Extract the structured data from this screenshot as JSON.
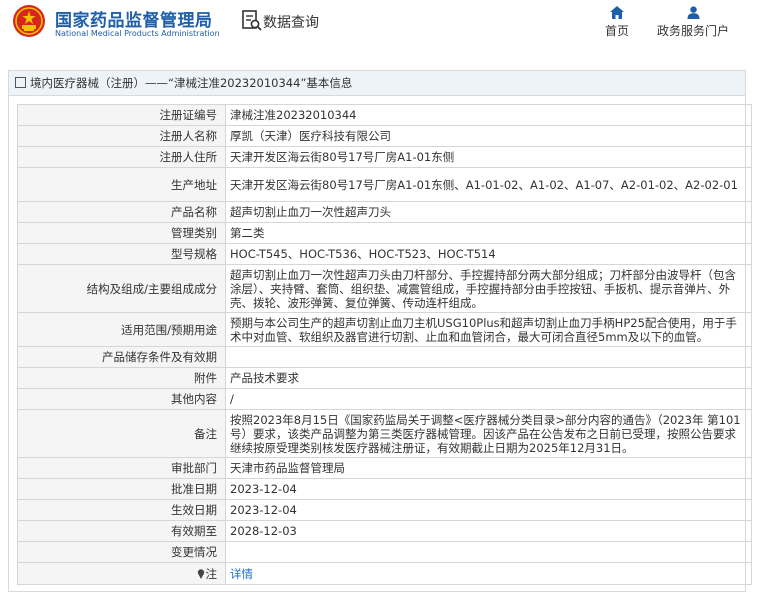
{
  "header": {
    "brand_cn": "国家药品监督管理局",
    "brand_en": "National Medical Products Administration",
    "query_label": "数据查询",
    "nav": [
      {
        "label": "首页",
        "icon": "home-icon"
      },
      {
        "label": "政务服务门户",
        "icon": "user-icon"
      }
    ],
    "brand_color": "#1f5ea8"
  },
  "breadcrumb": {
    "part1": "境内医疗器械（注册）",
    "part2": "——“津械注准20232010344”基本信息"
  },
  "table": {
    "rows": [
      {
        "label": "注册证编号",
        "value": "津械注准20232010344"
      },
      {
        "label": "注册人名称",
        "value": "厚凯（天津）医疗科技有限公司"
      },
      {
        "label": "注册人住所",
        "value": "天津开发区海云街80号17号厂房A1-01东侧"
      },
      {
        "label": "生产地址",
        "value": "天津开发区海云街80号17号厂房A1-01东侧、A1-01-02、A1-02、A1-07、A2-01-02、A2-02-01"
      },
      {
        "label": "产品名称",
        "value": "超声切割止血刀一次性超声刀头"
      },
      {
        "label": "管理类别",
        "value": "第二类"
      },
      {
        "label": "型号规格",
        "value": "HOC-T545、HOC-T536、HOC-T523、HOC-T514"
      },
      {
        "label": "结构及组成/主要组成成分",
        "value": "超声切割止血刀一次性超声刀头由刀杆部分、手控握持部分两大部分组成；刀杆部分由波导杆（包含涂层）、夹持臂、套筒、组织垫、减震管组成，手控握持部分由手控按钮、手扳机、提示音弹片、外壳、拨轮、波形弹簧、复位弹簧、传动连杆组成。"
      },
      {
        "label": "适用范围/预期用途",
        "value": "预期与本公司生产的超声切割止血刀主机USG10Plus和超声切割止血刀手柄HP25配合使用，用于手术中对血管、软组织及器官进行切割、止血和血管闭合，最大可闭合直径5mm及以下的血管。"
      },
      {
        "label": "产品储存条件及有效期",
        "value": ""
      },
      {
        "label": "附件",
        "value": "产品技术要求"
      },
      {
        "label": "其他内容",
        "value": "/"
      },
      {
        "label": "备注",
        "value": "按照2023年8月15日《国家药监局关于调整<医疗器械分类目录>部分内容的通告》（2023年 第101号）要求，该类产品调整为第三类医疗器械管理。因该产品在公告发布之日前已受理，按照公告要求继续按原受理类别核发医疗器械注册证，有效期截止日期为2025年12月31日。"
      },
      {
        "label": "审批部门",
        "value": "天津市药品监督管理局"
      },
      {
        "label": "批准日期",
        "value": "2023-12-04"
      },
      {
        "label": "生效日期",
        "value": "2023-12-04"
      },
      {
        "label": "有效期至",
        "value": "2028-12-03"
      },
      {
        "label": "变更情况",
        "value": ""
      }
    ],
    "note_label": "注",
    "note_link": "详情"
  }
}
